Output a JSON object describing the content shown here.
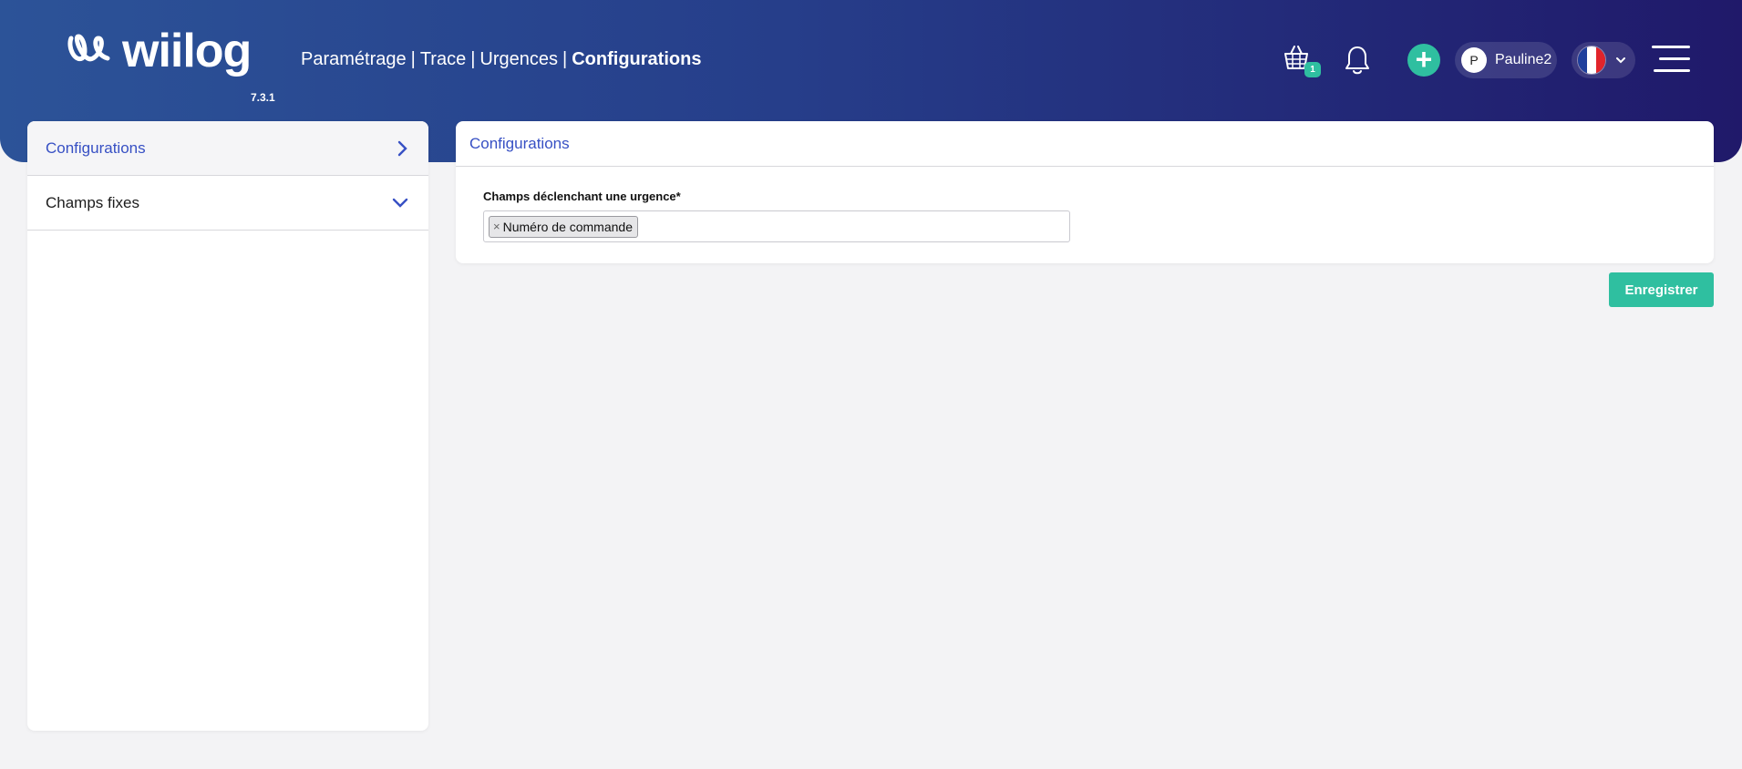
{
  "app": {
    "brand": "wiilog",
    "version": "7.3.1"
  },
  "breadcrumb": [
    {
      "label": "Paramétrage"
    },
    {
      "label": "Trace"
    },
    {
      "label": "Urgences"
    },
    {
      "label": "Configurations"
    }
  ],
  "breadcrumb_separator": "|",
  "header": {
    "basket_count": "1",
    "add_label": "+",
    "user": {
      "initial": "P",
      "name": "Pauline2"
    },
    "language": {
      "flag": "fr",
      "colors": [
        "#1e3f9c",
        "#ffffff",
        "#e1242b"
      ]
    }
  },
  "sidebar": {
    "items": [
      {
        "label": "Configurations",
        "icon": "chevron-right-icon",
        "active": true
      },
      {
        "label": "Champs fixes",
        "icon": "chevron-down-icon",
        "active": false
      }
    ]
  },
  "panel": {
    "title": "Configurations",
    "field_label": "Champs déclenchant une urgence*",
    "selected_tags": [
      {
        "remove": "×",
        "label": "Numéro de commande"
      }
    ]
  },
  "actions": {
    "save_label": "Enregistrer"
  },
  "colors": {
    "accent": "#2fbfa0",
    "link": "#3750c4",
    "header_start": "#2c5398",
    "header_end": "#20196a"
  }
}
